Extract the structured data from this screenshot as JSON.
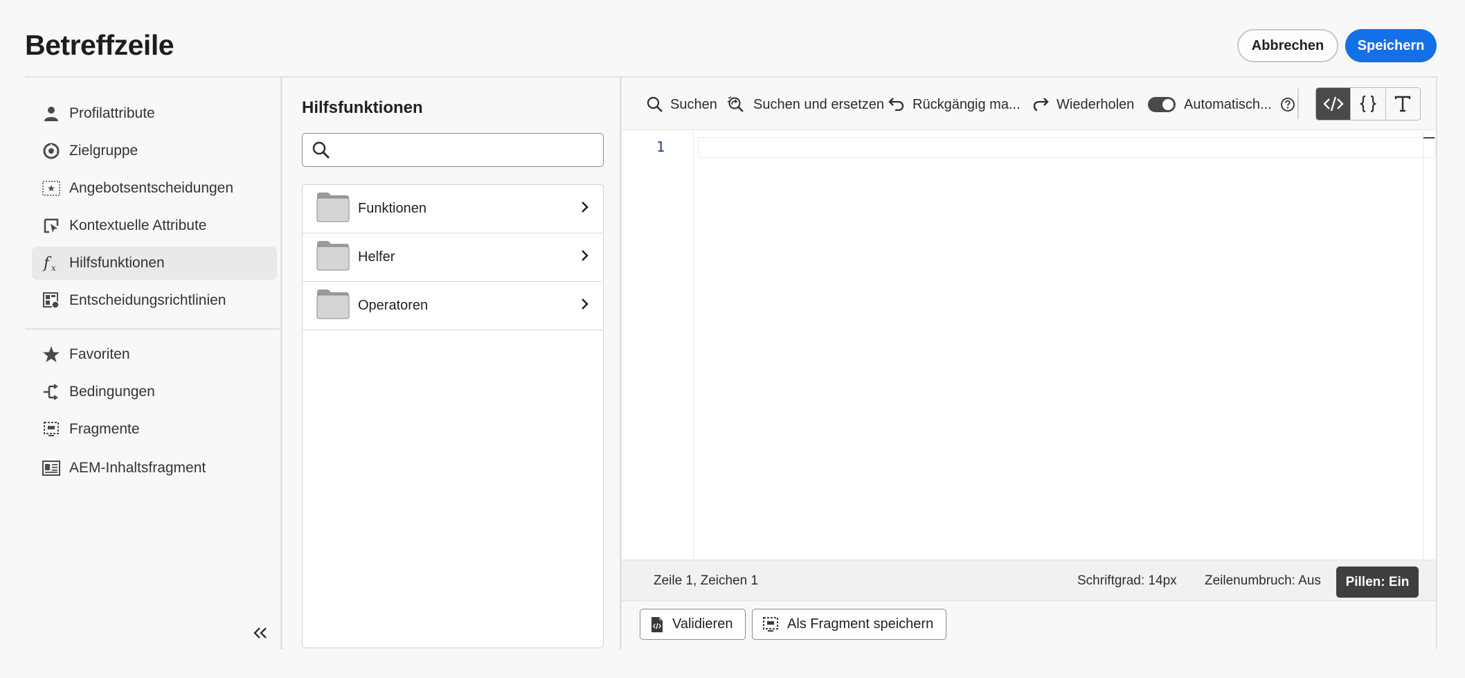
{
  "header": {
    "title": "Betreffzeile",
    "cancel_label": "Abbrechen",
    "save_label": "Speichern"
  },
  "sidebar": {
    "items": [
      {
        "label": "Profilattribute",
        "icon": "user-icon"
      },
      {
        "label": "Zielgruppe",
        "icon": "audience-icon"
      },
      {
        "label": "Angebotsentscheidungen",
        "icon": "offer-decision-icon"
      },
      {
        "label": "Kontextuelle Attribute",
        "icon": "contextual-attribute-icon"
      },
      {
        "label": "Hilfsfunktionen",
        "icon": "function-icon",
        "active": true
      },
      {
        "label": "Entscheidungsrichtlinien",
        "icon": "decision-policy-icon"
      }
    ],
    "items2": [
      {
        "label": "Favoriten",
        "icon": "star-icon"
      },
      {
        "label": "Bedingungen",
        "icon": "conditions-icon"
      },
      {
        "label": "Fragmente",
        "icon": "fragment-icon"
      },
      {
        "label": "AEM-Inhaltsfragment",
        "icon": "content-fragment-icon"
      }
    ]
  },
  "helpers": {
    "title": "Hilfsfunktionen",
    "search_placeholder": "",
    "folders": [
      "Funktionen",
      "Helfer",
      "Operatoren"
    ]
  },
  "toolbar": {
    "search": "Suchen",
    "search_replace": "Suchen und ersetzen",
    "undo": "Rückgängig ma...",
    "redo": "Wiederholen",
    "auto": "Automatisch..."
  },
  "editor": {
    "line_number": "1"
  },
  "status": {
    "position": "Zeile 1, Zeichen 1",
    "font_size": "Schriftgrad: 14px",
    "line_wrap": "Zeilenumbruch: Aus",
    "pills": "Pillen: Ein"
  },
  "bottom": {
    "validate": "Validieren",
    "save_fragment": "Als Fragment speichern"
  }
}
